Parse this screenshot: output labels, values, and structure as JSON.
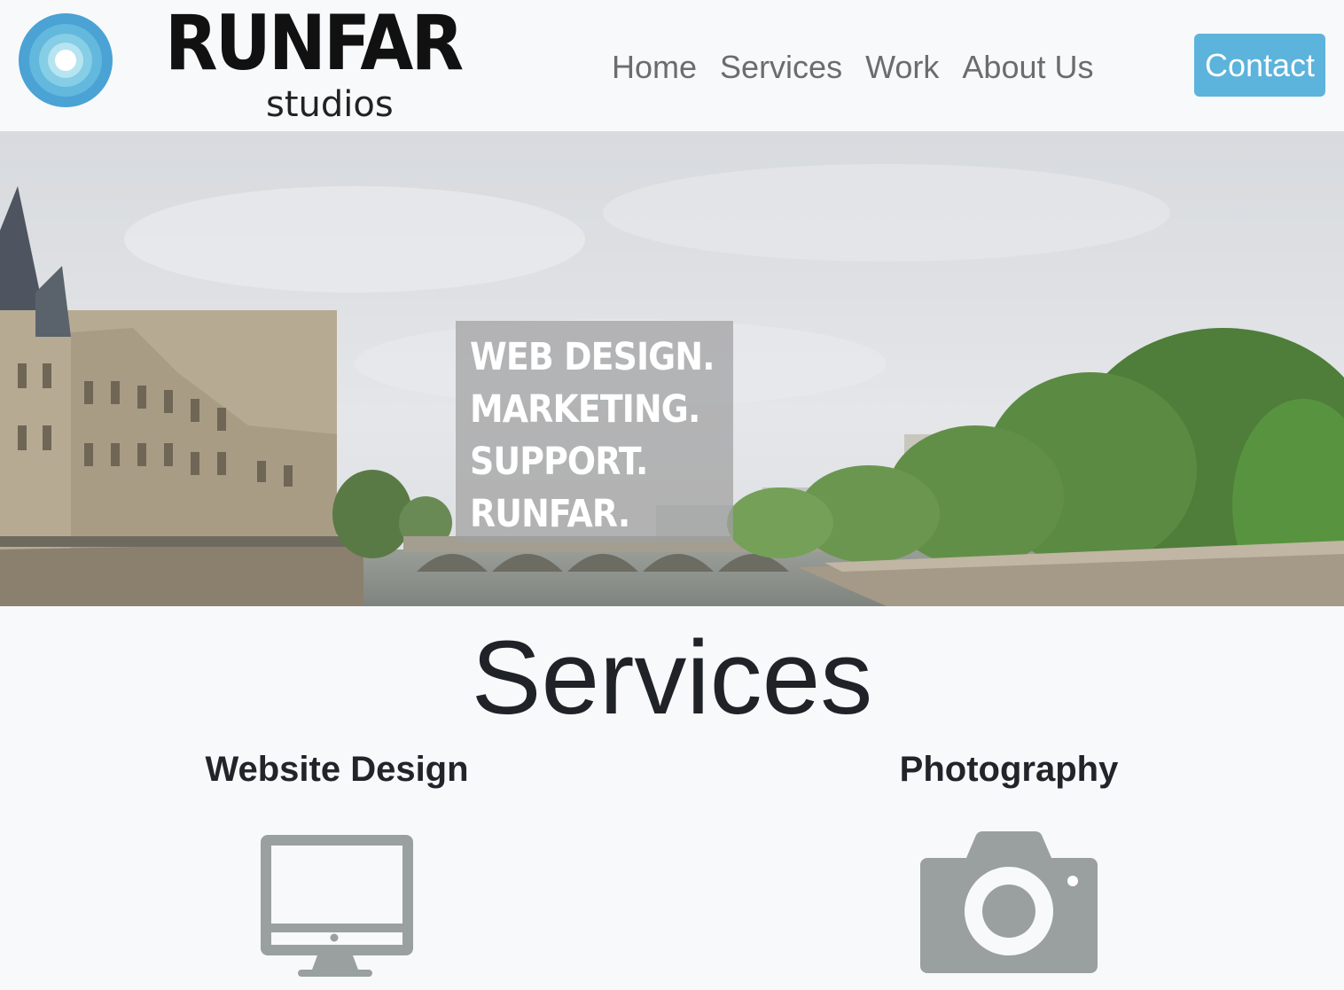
{
  "brand": {
    "name": "RUNFAR",
    "subtitle": "studios"
  },
  "nav": {
    "links": [
      {
        "label": "Home"
      },
      {
        "label": "Services"
      },
      {
        "label": "Work"
      },
      {
        "label": "About Us"
      }
    ],
    "contact_label": "Contact"
  },
  "hero": {
    "lines": [
      "WEB DESIGN.",
      "MARKETING.",
      "SUPPORT.",
      "RUNFAR."
    ]
  },
  "services": {
    "title": "Services",
    "items": [
      {
        "heading": "Website Design",
        "icon": "desktop-icon"
      },
      {
        "heading": "Photography",
        "icon": "camera-icon"
      }
    ]
  },
  "colors": {
    "accent": "#5cb3dc",
    "icon_gray": "#9aa0a0",
    "nav_text": "#6c6c6c",
    "background": "#f8f9fb"
  }
}
